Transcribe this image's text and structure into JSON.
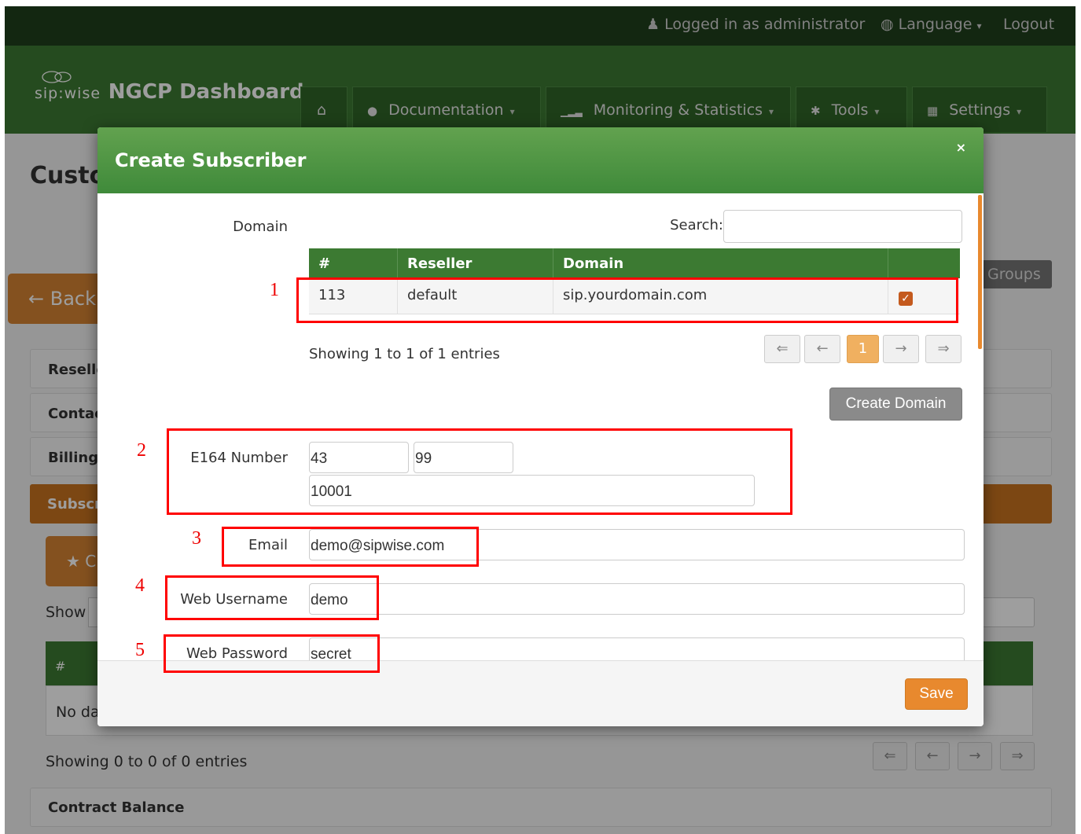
{
  "topbar": {
    "logged_in": "Logged in as administrator",
    "language": "Language",
    "logout": "Logout"
  },
  "header": {
    "logo_sip": "sip:wise",
    "title": "NGCP Dashboard",
    "nav": [
      {
        "label": "",
        "icon": "home-icon"
      },
      {
        "label": "Documentation",
        "icon": "info-circle-icon"
      },
      {
        "label": "Monitoring & Statistics",
        "icon": "signal-bars-icon"
      },
      {
        "label": "Tools",
        "icon": "gear-icon"
      },
      {
        "label": "Settings",
        "icon": "grid-icon"
      }
    ]
  },
  "background": {
    "page_title": "Custo",
    "back_label": "← Back",
    "groups_label": "Groups",
    "panels": [
      "Reselle",
      "Contac",
      "Billing"
    ],
    "subscribers_panel": "Subscr",
    "create_label": "★ C",
    "show_label": "Show",
    "table_head": "#",
    "no_data": "No da",
    "showing": "Showing 0 to 0 of 0 entries",
    "pager": [
      "⇐",
      "←",
      "→",
      "⇒"
    ],
    "contract_balance": "Contract Balance"
  },
  "modal": {
    "title": "Create Subscriber",
    "close": "×",
    "domain_label": "Domain",
    "search_label": "Search:",
    "search_value": "",
    "table": {
      "columns": [
        "#",
        "Reseller",
        "Domain",
        ""
      ],
      "rows": [
        {
          "id": "113",
          "reseller": "default",
          "domain": "sip.yourdomain.com",
          "selected": true
        }
      ]
    },
    "showing": "Showing 1 to 1 of 1 entries",
    "pager": [
      "⇐",
      "←",
      "1",
      "→",
      "⇒"
    ],
    "create_domain": "Create Domain",
    "e164_label": "E164 Number",
    "e164_cc": "43",
    "e164_ac": "99",
    "e164_sn": "10001",
    "email_label": "Email",
    "email_value": "demo@sipwise.com",
    "webuser_label": "Web Username",
    "webuser_value": "demo",
    "webpass_label": "Web Password",
    "webpass_value": "secret",
    "save": "Save"
  },
  "annotations": [
    "1",
    "2",
    "3",
    "4",
    "5"
  ],
  "colors": {
    "header_green": "#3c7a32",
    "topbar_dark": "#1f3f1c",
    "accent_orange": "#e8892e",
    "annotation_red": "#ff0000"
  }
}
